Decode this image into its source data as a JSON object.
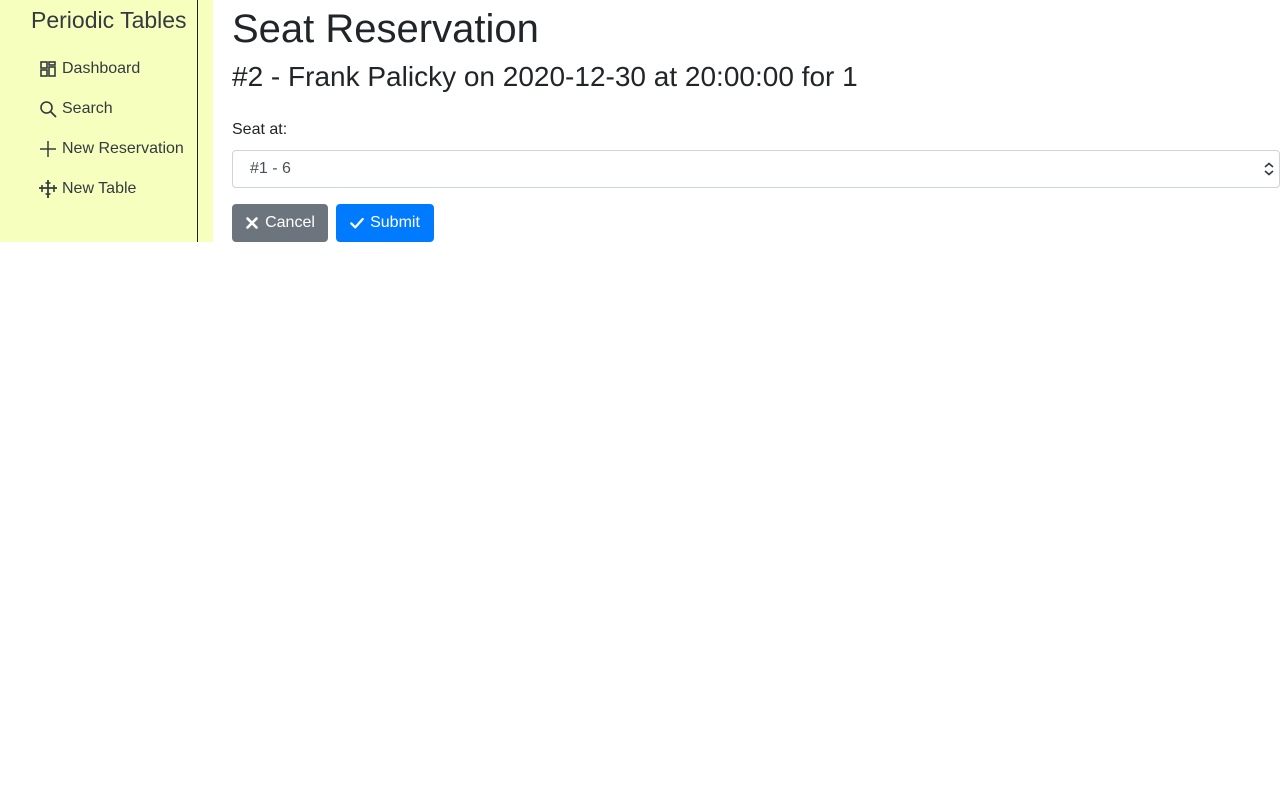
{
  "sidebar": {
    "brand": "Periodic Tables",
    "items": [
      {
        "label": "Dashboard",
        "icon": "dashboard-icon"
      },
      {
        "label": "Search",
        "icon": "search-icon"
      },
      {
        "label": "New Reservation",
        "icon": "plus-icon"
      },
      {
        "label": "New Table",
        "icon": "table-icon"
      }
    ],
    "background": "#f7ffbe"
  },
  "main": {
    "title": "Seat Reservation",
    "subtitle": "#2 - Frank Palicky on 2020-12-30 at 20:00:00 for 1",
    "form": {
      "label": "Seat at:",
      "selected": "#1 - 6"
    },
    "buttons": {
      "cancel": "Cancel",
      "submit": "Submit"
    },
    "colors": {
      "cancel": "#6c757d",
      "submit": "#007bff"
    }
  }
}
